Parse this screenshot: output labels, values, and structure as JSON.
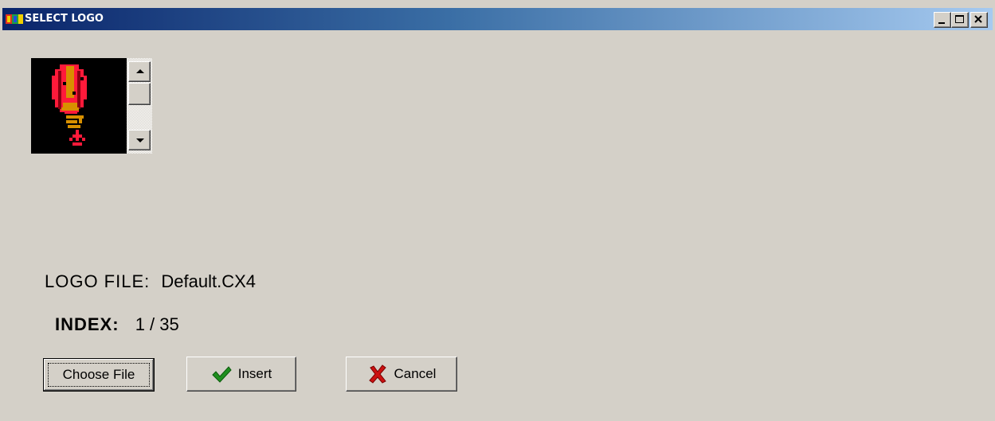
{
  "window": {
    "title": "SELECT LOGO",
    "app_icon": "edl-app-icon",
    "controls": [
      "minimize-icon",
      "maximize-icon",
      "close-icon"
    ]
  },
  "logo_preview": {
    "image": "hot-air-balloon-logo",
    "scrollbar_position": "1/35"
  },
  "info": {
    "file_label": "LOGO FILE:",
    "file_value": "Default.CX4",
    "index_label": "INDEX:",
    "index_value": "1 / 35"
  },
  "buttons": {
    "choose_file": "Choose File",
    "insert": "Insert",
    "insert_icon": "checkmark-icon",
    "cancel": "Cancel",
    "cancel_icon": "x-mark-icon"
  },
  "colors": {
    "titlebar_start": "#0a246a",
    "titlebar_end": "#a6caf0",
    "dialog_bg": "#d4d0c8",
    "checkmark": "#1f8f1f",
    "cancel_x": "#cc1111"
  }
}
